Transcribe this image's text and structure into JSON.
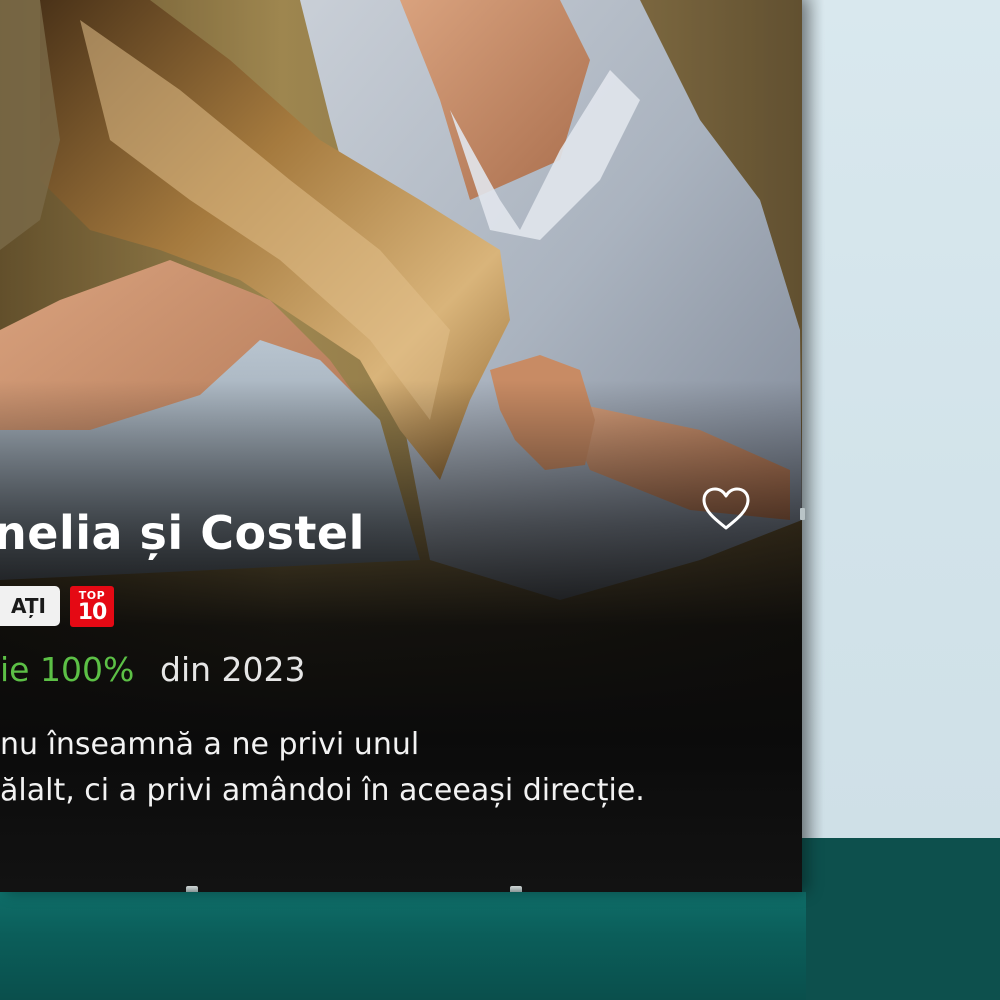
{
  "poster": {
    "title": "nelia și Costel",
    "badge_label": "AȚI",
    "top_badge": {
      "line1": "TOP",
      "line2": "10"
    },
    "match": "ie 100%",
    "year": "din 2023",
    "description": [
      "nu înseamnă a ne privi unul",
      "ălalt, ci a privi amândoi în aceeași direcție."
    ],
    "icons": {
      "favorite": "heart-outline-icon"
    }
  },
  "colors": {
    "match_green": "#5cc046",
    "top_badge_red": "#e50914",
    "shelf_teal": "#0d504d",
    "wall": "#d4e5ec"
  }
}
